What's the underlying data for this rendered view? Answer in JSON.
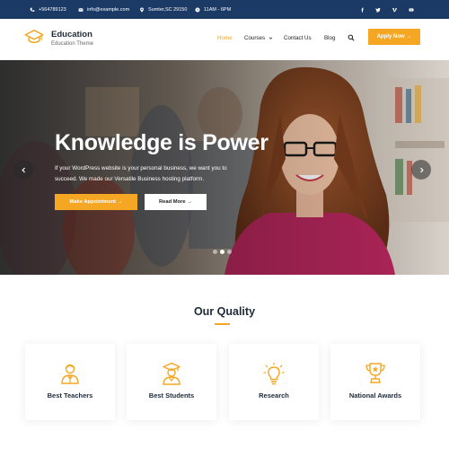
{
  "colors": {
    "topbar": "#1c3a66",
    "accent": "#f5a623",
    "white": "#ffffff"
  },
  "topbar": {
    "phone": "+564789123",
    "email": "info@example.com",
    "location": "Sumter,SC 29150",
    "hours": "11AM - 6PM",
    "socials": [
      "facebook-icon",
      "twitter-icon",
      "vimeo-icon",
      "youtube-icon"
    ]
  },
  "header": {
    "brand": "Education",
    "tagline": "Education Theme",
    "nav": [
      {
        "label": "Home",
        "active": true
      },
      {
        "label": "Courses",
        "has_dropdown": true
      },
      {
        "label": "Contact Us"
      },
      {
        "label": "Blog"
      }
    ],
    "apply_label": "Apply Now →"
  },
  "hero": {
    "title": "Knowledge is Power",
    "text": "If your WordPress website is your personal business, we want you to succeed. We made our Versatile Business hosting platform.",
    "primary_button": "Make Appointment →",
    "secondary_button": "Read More →",
    "slide_count": 3,
    "active_slide": 2
  },
  "quality": {
    "title": "Our Quality",
    "cards": [
      {
        "label": "Best Teachers",
        "icon": "teacher-icon"
      },
      {
        "label": "Best Students",
        "icon": "graduate-icon"
      },
      {
        "label": "Research",
        "icon": "lightbulb-icon"
      },
      {
        "label": "National Awards",
        "icon": "trophy-icon"
      }
    ]
  }
}
